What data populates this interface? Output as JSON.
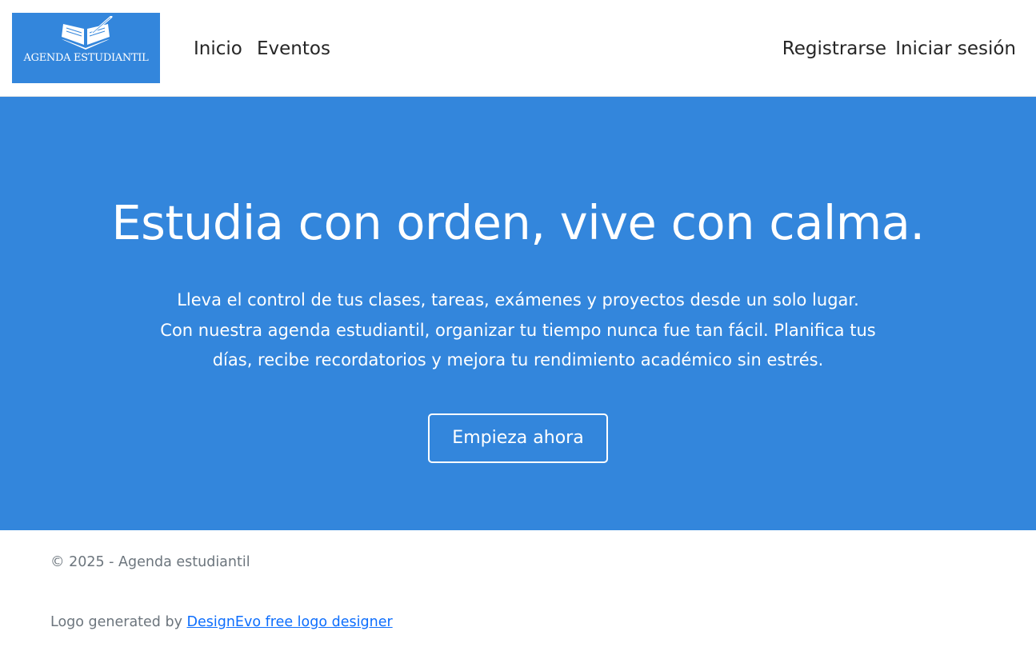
{
  "brand": {
    "logo_text": "AGENDA ESTUDIANTIL",
    "logo_background": "#3386dc",
    "logo_icon": "open-book-pen-icon"
  },
  "nav": {
    "left": [
      {
        "label": "Inicio"
      },
      {
        "label": "Eventos"
      }
    ],
    "right": [
      {
        "label": "Registrarse"
      },
      {
        "label": "Iniciar sesión"
      }
    ]
  },
  "hero": {
    "title": "Estudia con orden, vive con calma.",
    "text": "Lleva el control de tus clases, tareas, exámenes y proyectos desde un solo lugar. Con nuestra agenda estudiantil, organizar tu tiempo nunca fue tan fácil. Planifica tus días, recibe recordatorios y mejora tu rendimiento académico sin estrés.",
    "cta_label": "Empieza ahora",
    "background": "#3386dc"
  },
  "footer": {
    "copyright": "© 2025 - Agenda estudiantil",
    "credit_prefix": "Logo generated by ",
    "credit_link": "DesignEvo free logo designer",
    "link_color": "#0d6efd"
  }
}
